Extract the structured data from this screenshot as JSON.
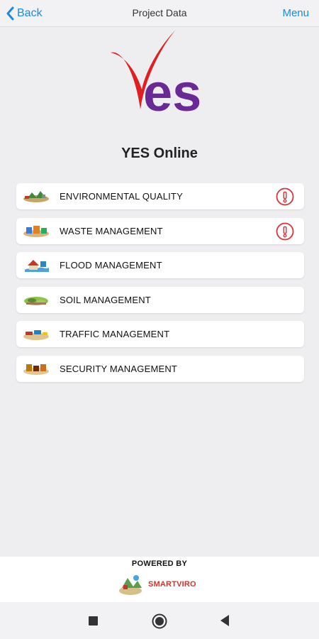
{
  "header": {
    "back_label": "Back",
    "title": "Project Data",
    "menu_label": "Menu"
  },
  "logo": {
    "text": "es",
    "colors": {
      "check": "#e02020",
      "letters": "#6a2a96"
    }
  },
  "app_title": "YES Online",
  "menu_items": [
    {
      "label": "ENVIRONMENTAL QUALITY",
      "icon": "environment-icon",
      "alert": true
    },
    {
      "label": "WASTE MANAGEMENT",
      "icon": "waste-icon",
      "alert": true
    },
    {
      "label": "FLOOD MANAGEMENT",
      "icon": "flood-icon",
      "alert": false
    },
    {
      "label": "SOIL MANAGEMENT",
      "icon": "soil-icon",
      "alert": false
    },
    {
      "label": "TRAFFIC MANAGEMENT",
      "icon": "traffic-icon",
      "alert": false
    },
    {
      "label": "SECURITY MANAGEMENT",
      "icon": "security-icon",
      "alert": false
    }
  ],
  "alert_color": "#d9343a",
  "accent_color": "#1a8be0",
  "footer": {
    "powered_by": "POWERED BY",
    "brand_name": "SMARTVIRO"
  },
  "navbar": {
    "buttons": [
      "recent-apps-icon",
      "home-icon",
      "back-triangle-icon"
    ]
  }
}
